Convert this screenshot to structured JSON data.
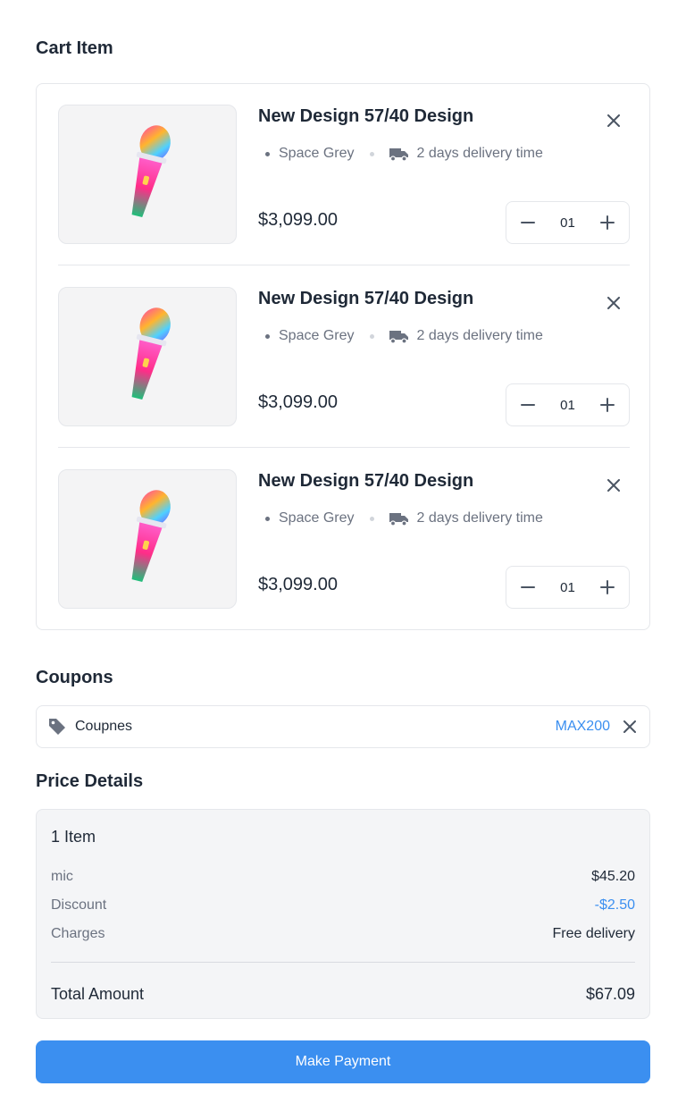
{
  "headings": {
    "cart": "Cart Item",
    "coupons": "Coupons",
    "price_details": "Price Details"
  },
  "cart_items": [
    {
      "name": "New Design 57/40 Design",
      "color": "Space Grey",
      "delivery": "2 days delivery time",
      "price": "$3,099.00",
      "qty": "01"
    },
    {
      "name": "New Design 57/40 Design",
      "color": "Space Grey",
      "delivery": "2 days delivery time",
      "price": "$3,099.00",
      "qty": "01"
    },
    {
      "name": "New Design 57/40 Design",
      "color": "Space Grey",
      "delivery": "2 days delivery time",
      "price": "$3,099.00",
      "qty": "01"
    }
  ],
  "coupon": {
    "label": "Coupnes",
    "code": "MAX200"
  },
  "price_details": {
    "count": "1 Item",
    "rows": [
      {
        "label": "mic",
        "value": "$45.20"
      },
      {
        "label": "Discount",
        "value": "-$2.50"
      },
      {
        "label": "Charges",
        "value": "Free delivery"
      }
    ],
    "total_label": "Total Amount",
    "total_value": "$67.09"
  },
  "actions": {
    "pay": "Make Payment"
  },
  "colors": {
    "accent": "#3b8ff0",
    "text": "#1f2937",
    "muted": "#6b7280",
    "border": "#e5e7eb"
  }
}
